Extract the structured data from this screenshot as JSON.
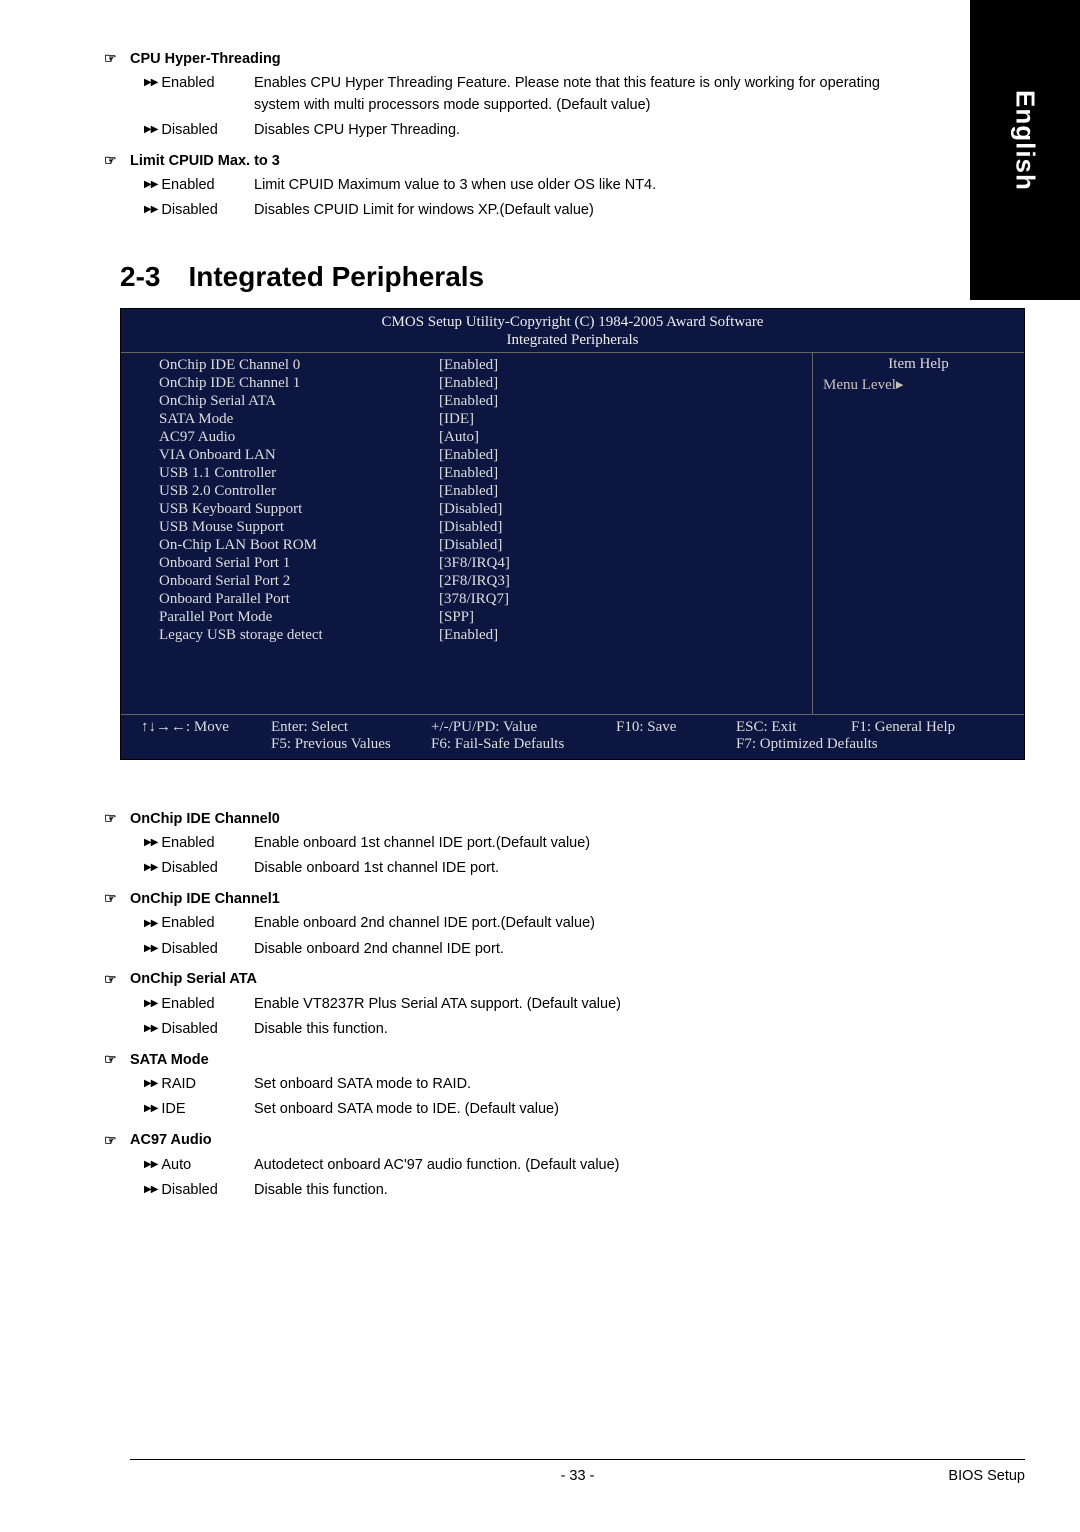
{
  "side_tab": "English",
  "upper_options": [
    {
      "title": "CPU Hyper-Threading",
      "rows": [
        {
          "label": "Enabled",
          "desc": "Enables CPU Hyper Threading Feature. Please note that this feature is only working for operating system with multi processors mode supported. (Default value)"
        },
        {
          "label": "Disabled",
          "desc": "Disables CPU Hyper Threading."
        }
      ]
    },
    {
      "title": "Limit CPUID Max. to 3",
      "rows": [
        {
          "label": "Enabled",
          "desc": "Limit CPUID Maximum value to 3 when use older OS like NT4."
        },
        {
          "label": "Disabled",
          "desc": "Disables CPUID Limit for windows XP.(Default value)"
        }
      ]
    }
  ],
  "section": {
    "num": "2-3",
    "title": "Integrated Peripherals"
  },
  "bios": {
    "header_line1": "CMOS Setup Utility-Copyright (C) 1984-2005 Award Software",
    "header_line2": "Integrated Peripherals",
    "rows": [
      {
        "k": "OnChip IDE Channel 0",
        "v": "[Enabled]"
      },
      {
        "k": "OnChip IDE Channel 1",
        "v": "[Enabled]"
      },
      {
        "k": "OnChip Serial ATA",
        "v": "[Enabled]"
      },
      {
        "k": "SATA Mode",
        "v": "[IDE]"
      },
      {
        "k": "AC97 Audio",
        "v": "[Auto]"
      },
      {
        "k": "VIA Onboard LAN",
        "v": "[Enabled]"
      },
      {
        "k": "USB 1.1 Controller",
        "v": "[Enabled]"
      },
      {
        "k": "USB 2.0 Controller",
        "v": "[Enabled]"
      },
      {
        "k": "USB Keyboard Support",
        "v": "[Disabled]"
      },
      {
        "k": "USB Mouse Support",
        "v": "[Disabled]"
      },
      {
        "k": "On-Chip LAN Boot ROM",
        "v": "[Disabled]"
      },
      {
        "k": "Onboard Serial Port 1",
        "v": "[3F8/IRQ4]"
      },
      {
        "k": "Onboard Serial Port 2",
        "v": "[2F8/IRQ3]"
      },
      {
        "k": "Onboard Parallel Port",
        "v": "[378/IRQ7]"
      },
      {
        "k": "Parallel Port Mode",
        "v": "[SPP]"
      },
      {
        "k": "Legacy USB storage detect",
        "v": "[Enabled]"
      }
    ],
    "help_title": "Item Help",
    "menu_level": "Menu Level▸",
    "footer": {
      "r1c1": "↑↓→←: Move",
      "r1c2": "Enter: Select",
      "r1c3": "+/-/PU/PD: Value",
      "r1c4": "F10: Save",
      "r1c5": "ESC: Exit",
      "r1c6": "F1: General Help",
      "r2c2": "F5: Previous Values",
      "r2c3": "F6: Fail-Safe Defaults",
      "r2c5": "F7: Optimized Defaults"
    }
  },
  "lower_options": [
    {
      "title": "OnChip IDE Channel0",
      "rows": [
        {
          "label": "Enabled",
          "desc": "Enable onboard 1st channel IDE port.(Default value)"
        },
        {
          "label": "Disabled",
          "desc": "Disable onboard 1st channel IDE port."
        }
      ]
    },
    {
      "title": "OnChip IDE Channel1",
      "rows": [
        {
          "label": "Enabled",
          "desc": "Enable onboard 2nd channel IDE port.(Default value)"
        },
        {
          "label": "Disabled",
          "desc": "Disable onboard 2nd channel IDE port."
        }
      ]
    },
    {
      "title": "OnChip Serial ATA",
      "rows": [
        {
          "label": "Enabled",
          "desc": "Enable VT8237R Plus Serial ATA support. (Default value)"
        },
        {
          "label": "Disabled",
          "desc": "Disable this function."
        }
      ]
    },
    {
      "title": "SATA Mode",
      "rows": [
        {
          "label": "RAID",
          "desc": "Set onboard SATA mode to RAID."
        },
        {
          "label": "IDE",
          "desc": "Set onboard SATA mode to IDE. (Default value)"
        }
      ]
    },
    {
      "title": "AC97 Audio",
      "rows": [
        {
          "label": "Auto",
          "desc": "Autodetect onboard AC'97 audio function. (Default value)"
        },
        {
          "label": "Disabled",
          "desc": "Disable this function."
        }
      ]
    }
  ],
  "footer": {
    "page": "- 33 -",
    "section": "BIOS Setup"
  }
}
